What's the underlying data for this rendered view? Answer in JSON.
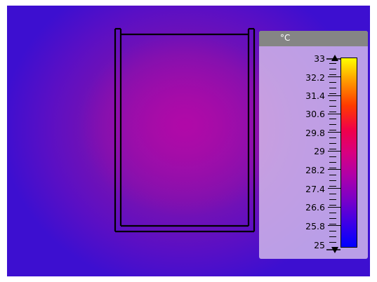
{
  "legend": {
    "unit": "°C",
    "ticks": [
      "33",
      "32.2",
      "31.4",
      "30.6",
      "29.8",
      "29",
      "28.2",
      "27.4",
      "26.6",
      "25.8",
      "25"
    ]
  },
  "colors": {
    "background_outer": "#3d0fd0",
    "background_inner": "#b208a8",
    "legend_header": "#858585",
    "legend_panel": "#d6beec"
  },
  "icons": {
    "max_marker": "triangle-up-icon",
    "min_marker": "triangle-down-icon"
  }
}
